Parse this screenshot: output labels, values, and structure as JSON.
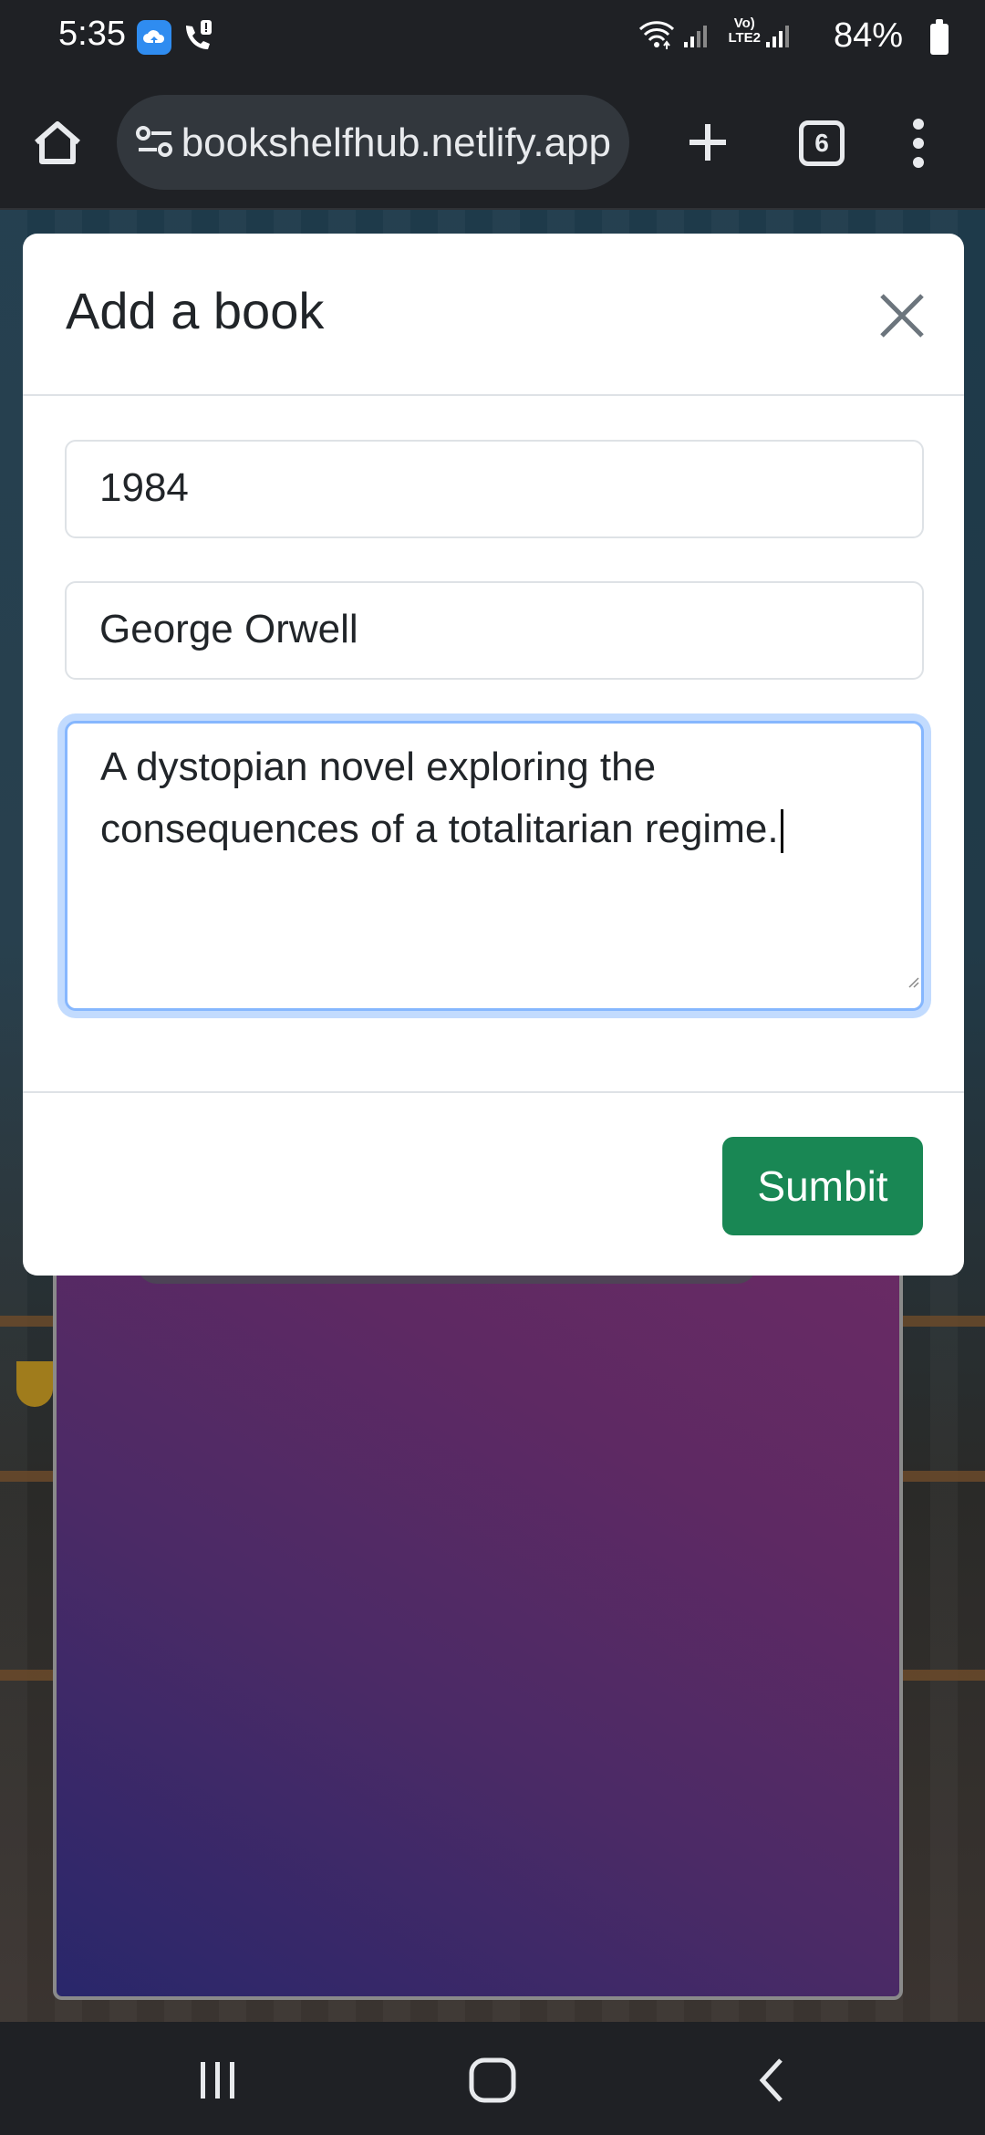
{
  "status_bar": {
    "time": "5:35",
    "battery_percent": "84%",
    "network_label_top": "Vo)",
    "network_label_bottom": "LTE2"
  },
  "browser": {
    "url": "bookshelfhub.netlify.app",
    "tab_count": "6"
  },
  "modal": {
    "title": "Add a book",
    "fields": {
      "title_value": "1984",
      "author_value": "George Orwell",
      "description_value": "A dystopian novel exploring the consequences of a totalitarian regime."
    },
    "submit_label": "Sumbit"
  },
  "colors": {
    "submit_button": "#198754",
    "focus_ring": "#86b7fe",
    "browser_chrome": "#1f2125"
  },
  "icons": [
    "home-icon",
    "site-settings-icon",
    "plus-icon",
    "tabs-icon",
    "more-vert-icon",
    "close-icon",
    "recents-icon",
    "nav-home-icon",
    "back-icon"
  ]
}
